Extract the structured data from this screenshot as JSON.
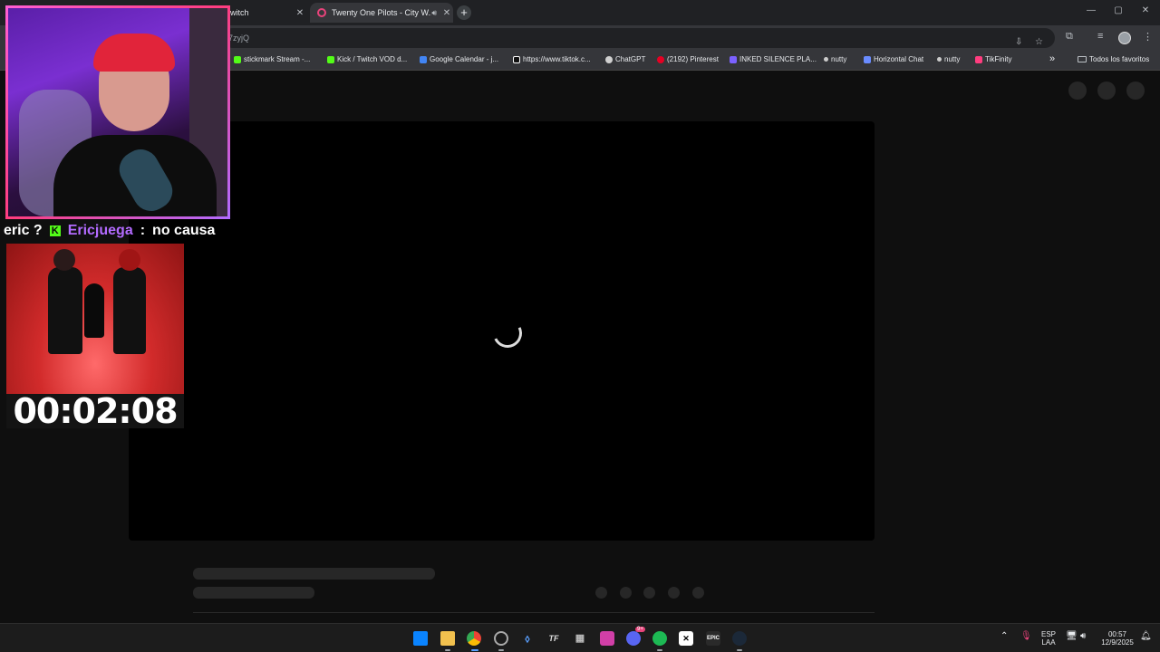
{
  "browser": {
    "tabs": [
      {
        "title": "witch",
        "close": "✕"
      },
      {
        "title": "Twenty One Pilots - City W...",
        "close": "✕",
        "audio_icon": "speaker-icon"
      }
    ],
    "new_tab_icon": "+",
    "window_controls": [
      "—",
      "▢",
      "✕"
    ],
    "address": "7zyjQ",
    "bookmarks": [
      {
        "label": "stickmark Stream -...",
        "color": "#53fc18"
      },
      {
        "label": "Kick / Twitch VOD d...",
        "color": "#53fc18"
      },
      {
        "label": "Google Calendar - j...",
        "color": "#4285f4"
      },
      {
        "label": "https://www.tiktok.c...",
        "color": "#ffffff"
      },
      {
        "label": "ChatGPT",
        "color": "#d0d0d0"
      },
      {
        "label": "(2192) Pinterest",
        "color": "#e60023"
      },
      {
        "label": "INKED SILENCE PLA...",
        "color": "#7b61ff"
      },
      {
        "label": "nutty",
        "color": "#cccccc"
      },
      {
        "label": "Horizontal Chat",
        "color": "#6a8cff"
      },
      {
        "label": "nutty",
        "color": "#cccccc"
      },
      {
        "label": "TikFinity",
        "color": "#ff3d7f"
      }
    ],
    "bookmarks_more": "»",
    "all_bookmarks": "Todos los favoritos"
  },
  "overlay": {
    "chat": {
      "prefix": "eric ?",
      "user": "Ericjuega",
      "separator": ":",
      "message": "no causa"
    },
    "timer": "00:02:08"
  },
  "taskbar": {
    "lang_top": "ESP",
    "lang_bottom": "LAA",
    "time": "00:57",
    "date": "12/9/2025",
    "badge": "9+"
  }
}
